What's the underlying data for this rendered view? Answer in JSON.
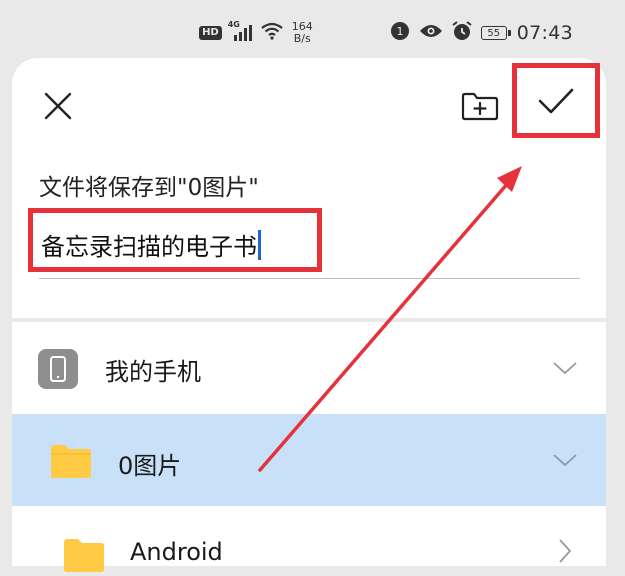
{
  "status_bar": {
    "hd_badge": "HD",
    "network_gen": "4G",
    "speed_value": "164",
    "speed_unit": "B/s",
    "battery_level": "55",
    "time": "07:43"
  },
  "dialog": {
    "save_hint": "文件将保存到\"0图片\"",
    "filename_value": "备忘录扫描的电子书"
  },
  "locations": [
    {
      "label": "我的手机",
      "icon": "phone-icon",
      "selected": false
    },
    {
      "label": "0图片",
      "icon": "folder-icon",
      "selected": true
    },
    {
      "label": "Android",
      "icon": "folder-icon",
      "selected": false
    }
  ],
  "colors": {
    "highlight_red": "#e5323b",
    "selected_row": "#c8e0f8",
    "folder_yellow": "#ffcb45",
    "caret_blue": "#1f63d6"
  }
}
